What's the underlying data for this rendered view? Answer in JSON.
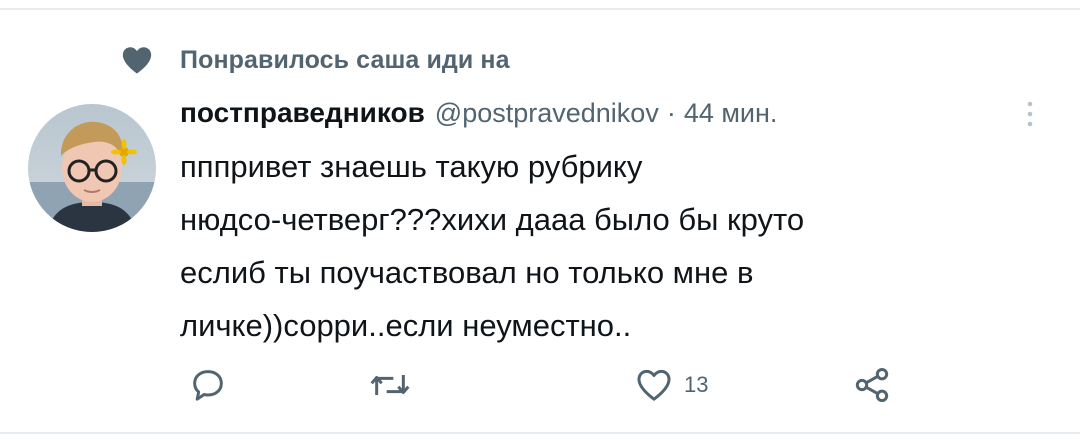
{
  "social_context": {
    "icon": "heart-filled-icon",
    "text": "Понравилось саша иди на"
  },
  "tweet": {
    "author": {
      "display_name": "постправедников",
      "handle": "@postpravednikov",
      "separator": "·",
      "time": "44 мин."
    },
    "text_lines": [
      "пппривет знаешь такую рубрику",
      "нюдсо-четверг???хихи дааа было бы круто",
      "еслиб ты поучаствовал но только мне в",
      "личке))сорри..если неуместно.."
    ],
    "actions": {
      "reply": {
        "icon": "reply-icon"
      },
      "retweet": {
        "icon": "retweet-icon"
      },
      "like": {
        "icon": "heart-outline-icon",
        "count": "13"
      },
      "share": {
        "icon": "share-icon"
      }
    }
  },
  "colors": {
    "text_primary": "#0f1419",
    "text_secondary": "#536471",
    "border": "#e6ecf0"
  }
}
